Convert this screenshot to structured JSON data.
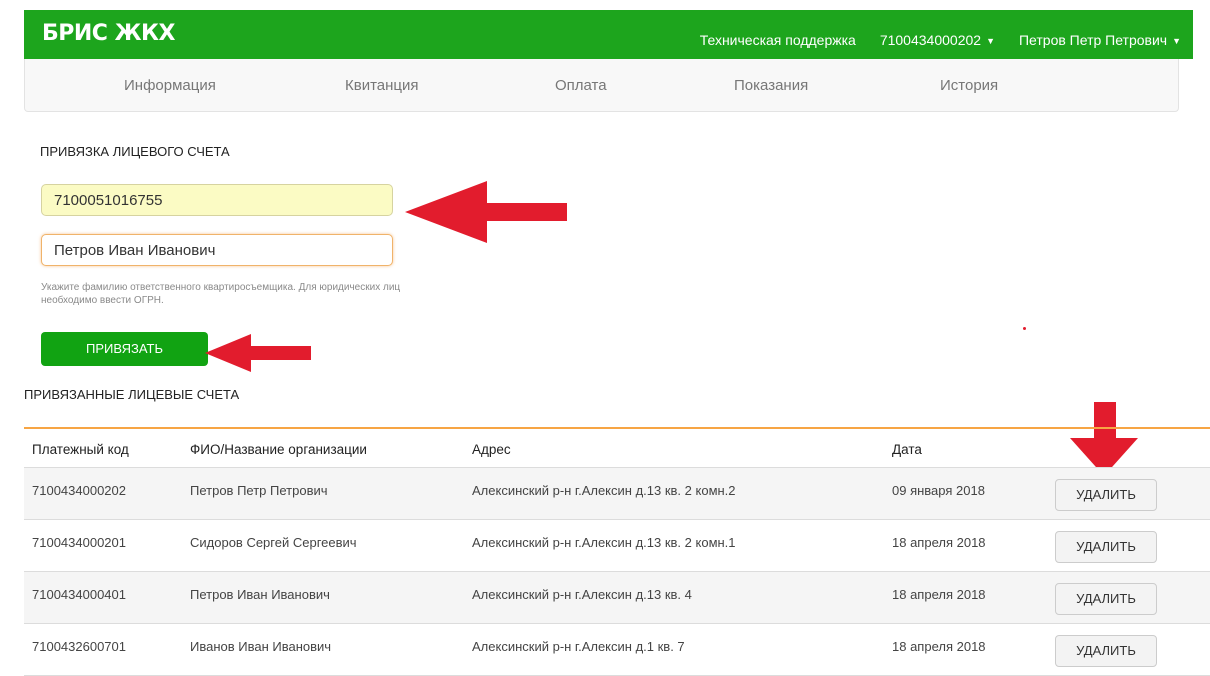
{
  "header": {
    "brand": "БРИС ЖКХ",
    "support": "Техническая поддержка",
    "account": "7100434000202",
    "user": "Петров Петр Петрович"
  },
  "menu": {
    "items": [
      "Информация",
      "Квитанция",
      "Оплата",
      "Показания",
      "История"
    ]
  },
  "bind_form": {
    "title": "ПРИВЯЗКА ЛИЦЕВОГО СЧЕТА",
    "account_value": "7100051016755",
    "name_value": "Петров Иван Иванович",
    "help": "Укажите фамилию ответственного квартиросъемщика. Для юридических лиц необходимо ввести ОГРН.",
    "button": "ПРИВЯЗАТЬ"
  },
  "linked": {
    "title": "ПРИВЯЗАННЫЕ ЛИЦЕВЫЕ СЧЕТА",
    "columns": [
      "Платежный код",
      "ФИО/Название организации",
      "Адрес",
      "Дата"
    ],
    "rows": [
      {
        "code": "7100434000202",
        "name": "Петров Петр Петрович",
        "address": "Алексинский р-н г.Алексин д.13 кв. 2 комн.2",
        "date": "09 января 2018",
        "action": "УДАЛИТЬ"
      },
      {
        "code": "7100434000201",
        "name": "Сидоров Сергей Сергеевич",
        "address": "Алексинский р-н г.Алексин д.13 кв. 2 комн.1",
        "date": "18 апреля 2018",
        "action": "УДАЛИТЬ"
      },
      {
        "code": "7100434000401",
        "name": "Петров Иван Иванович",
        "address": "Алексинский р-н г.Алексин д.13 кв. 4",
        "date": "18 апреля 2018",
        "action": "УДАЛИТЬ"
      },
      {
        "code": "7100432600701",
        "name": "Иванов Иван Иванович",
        "address": "Алексинский р-н г.Алексин д.1 кв. 7",
        "date": "18 апреля 2018",
        "action": "УДАЛИТЬ"
      }
    ]
  },
  "colors": {
    "brand_green": "#1da51d",
    "button_green": "#11a312",
    "table_accent": "#f7a544",
    "annotation_red": "#e21c2d"
  },
  "icons": [
    "caret-down-icon",
    "annotation-arrow-left-icon",
    "annotation-arrow-down-icon"
  ]
}
